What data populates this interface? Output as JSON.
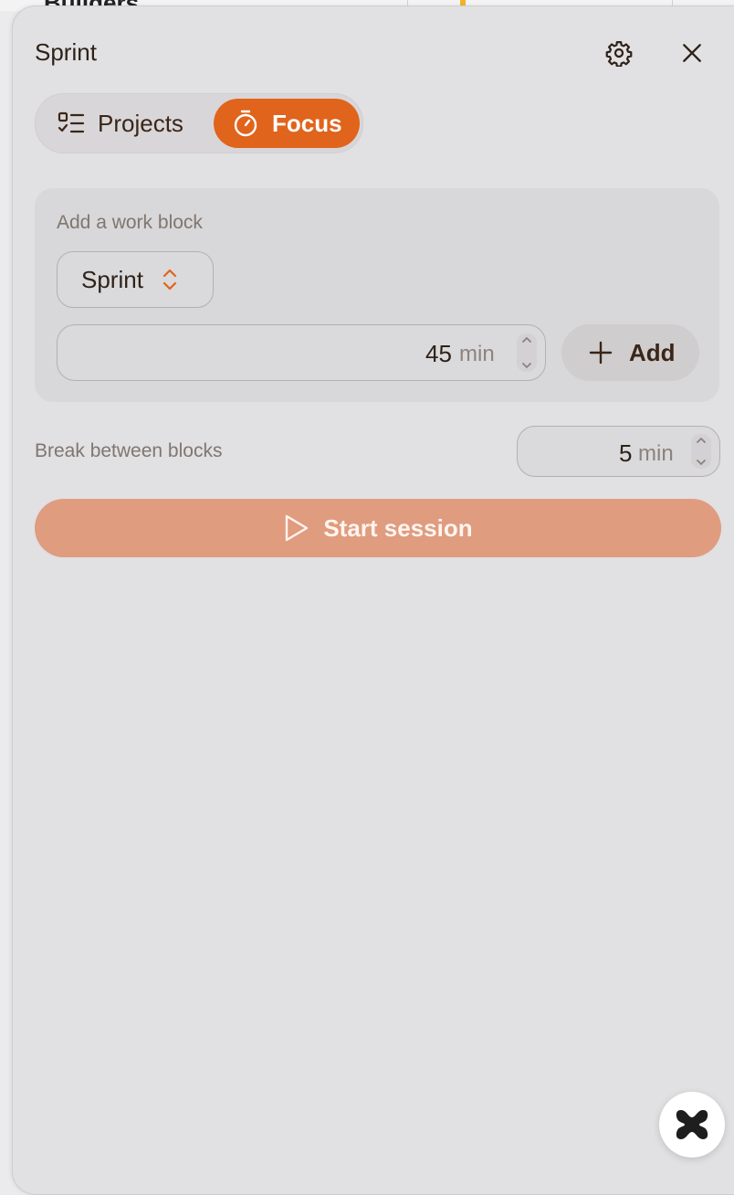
{
  "background": {
    "title_partial": "Builders"
  },
  "panel": {
    "title": "Sprint",
    "tabs": [
      {
        "label": "Projects",
        "icon": "checklist-icon",
        "active": false
      },
      {
        "label": "Focus",
        "icon": "stopwatch-icon",
        "active": true
      }
    ],
    "work_block": {
      "label": "Add a work block",
      "type_select": "Sprint",
      "duration_value": "45",
      "duration_unit": "min",
      "add_label": "Add"
    },
    "break": {
      "label": "Break between blocks",
      "value": "5",
      "unit": "min"
    },
    "start_label": "Start session"
  },
  "colors": {
    "accent": "#e0641c",
    "start_button": "#df9c7f",
    "panel_bg": "#e1e0e2"
  }
}
